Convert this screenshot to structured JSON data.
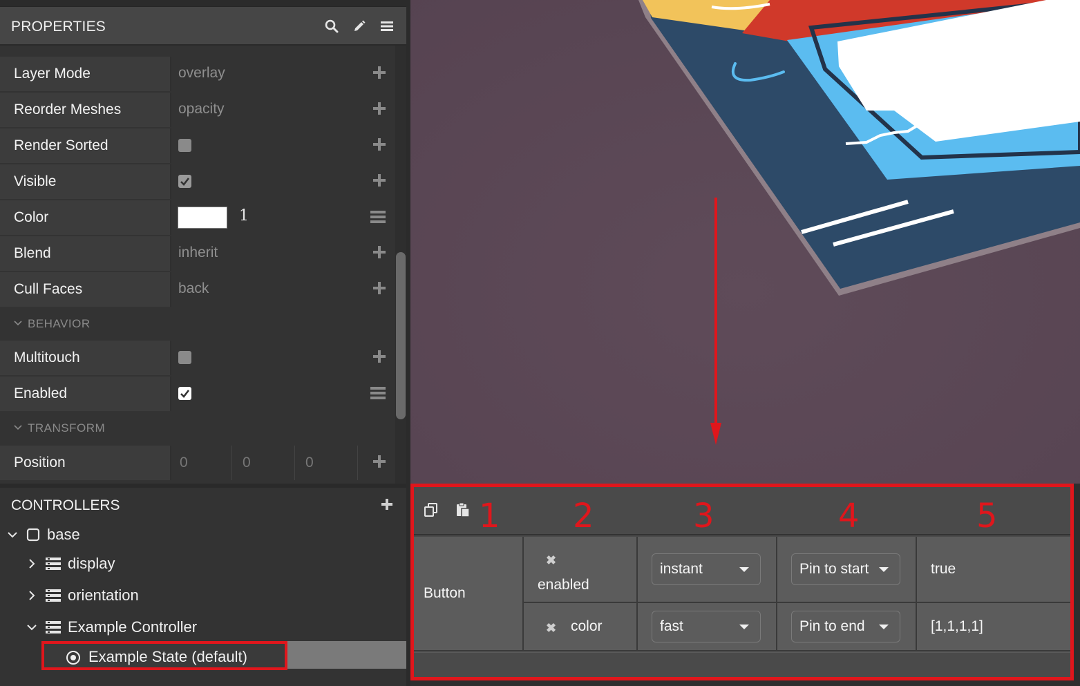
{
  "properties": {
    "title": "PROPERTIES",
    "rows": [
      {
        "label": "Layer Mode",
        "value": "overlay"
      },
      {
        "label": "Reorder Meshes",
        "value": "opacity"
      },
      {
        "label": "Render Sorted",
        "checked": false
      },
      {
        "label": "Visible",
        "checked": true
      },
      {
        "label": "Color",
        "swatch": "#ffffff",
        "alpha": "1"
      },
      {
        "label": "Blend",
        "value": "inherit"
      },
      {
        "label": "Cull Faces",
        "value": "back"
      }
    ],
    "behavior": {
      "title": "BEHAVIOR",
      "rows": [
        {
          "label": "Multitouch",
          "checked": false
        },
        {
          "label": "Enabled",
          "checked": true
        }
      ]
    },
    "transform": {
      "title": "TRANSFORM",
      "position": {
        "label": "Position",
        "x": "0",
        "y": "0",
        "z": "0"
      }
    }
  },
  "controllers": {
    "title": "CONTROLLERS",
    "tree": {
      "root": "base",
      "children": [
        "display",
        "orientation",
        "Example Controller"
      ],
      "state": "Example State (default)"
    }
  },
  "state_table": {
    "column_numbers": [
      "1",
      "2",
      "3",
      "4",
      "5"
    ],
    "target": "Button",
    "rows": [
      {
        "property": "enabled",
        "transition": "instant",
        "pin": "Pin to start",
        "value": "true"
      },
      {
        "property": "color",
        "transition": "fast",
        "pin": "Pin to end",
        "value": "[1,1,1,1]"
      }
    ]
  },
  "colors": {
    "highlight_red": "#e0161c",
    "viewport_bg": "#5c4a57",
    "accent_blue": "#5bbcf0"
  }
}
